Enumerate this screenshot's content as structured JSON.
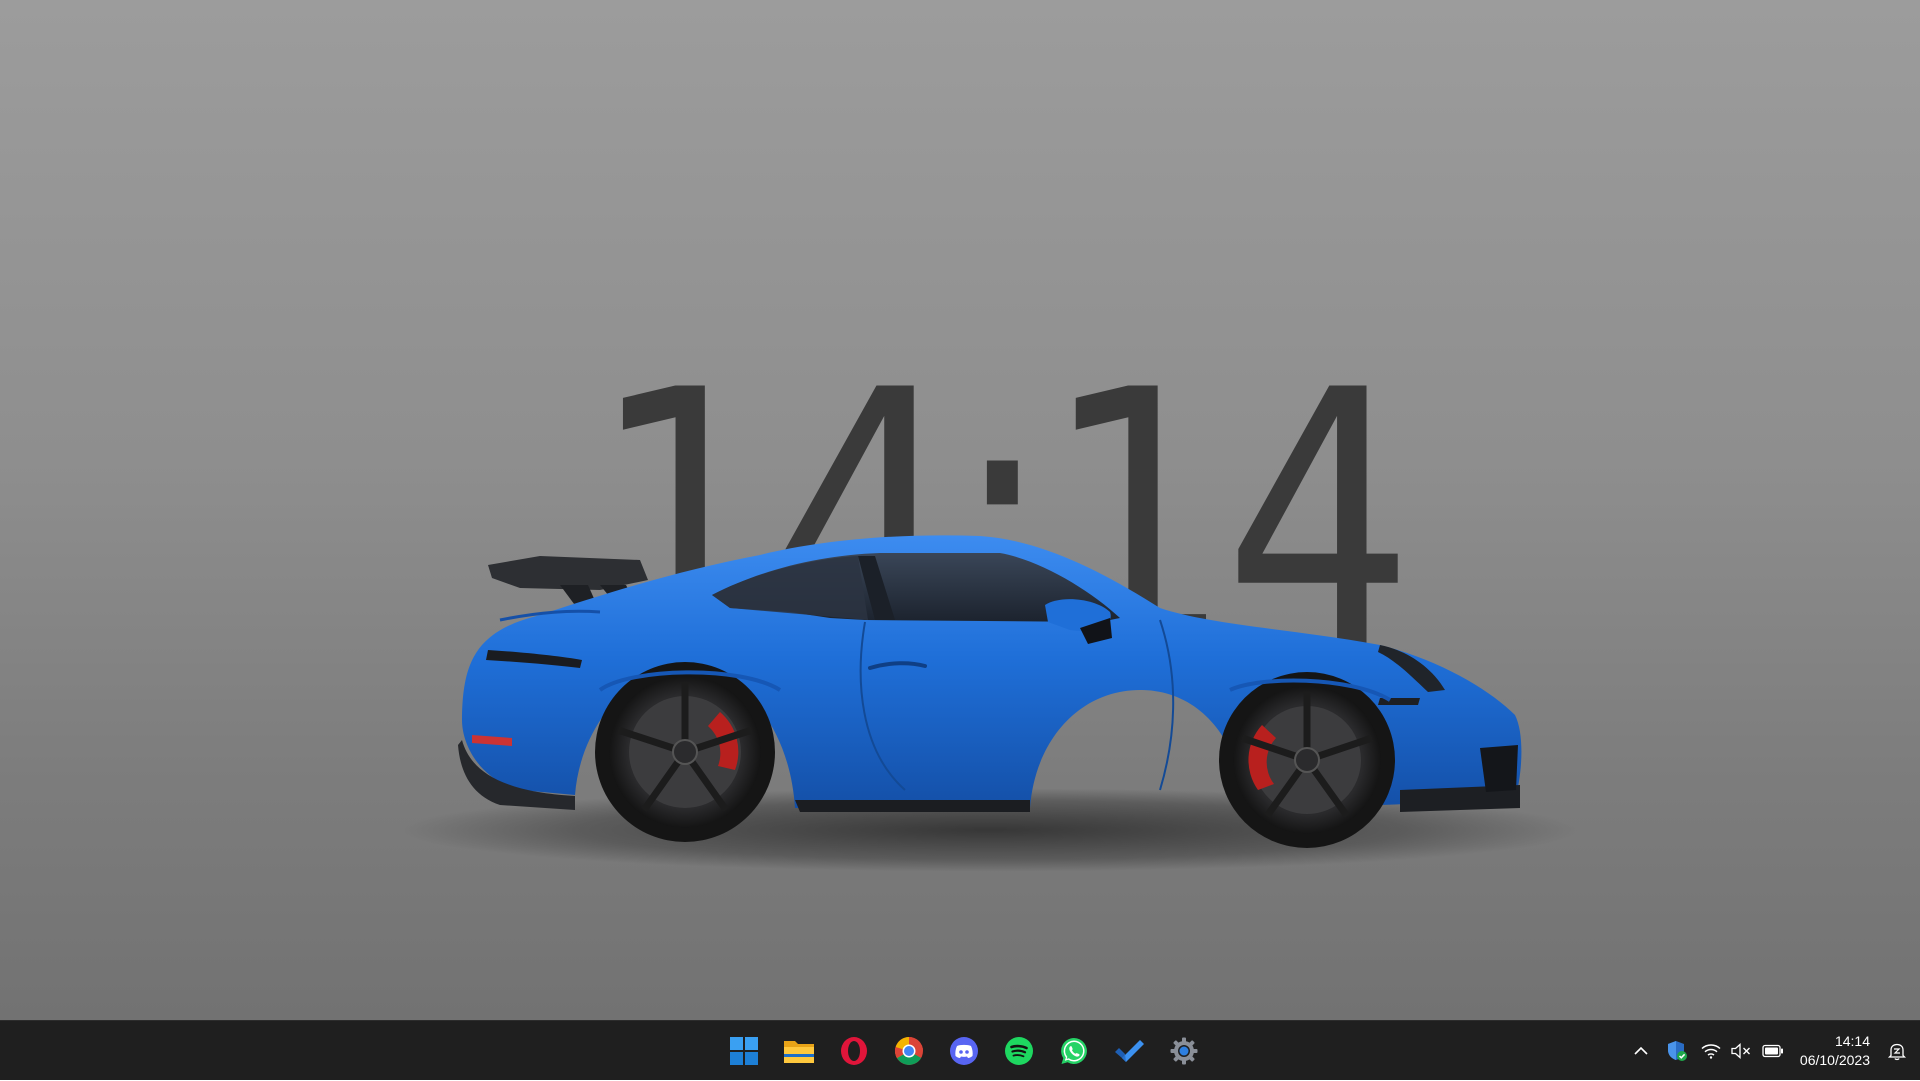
{
  "wallpaper": {
    "clock_text": "14:14"
  },
  "taskbar": {
    "apps": [
      {
        "name": "Start",
        "icon": "windows-start-icon"
      },
      {
        "name": "File Explorer",
        "icon": "file-explorer-icon"
      },
      {
        "name": "Opera",
        "icon": "opera-icon"
      },
      {
        "name": "Google Chrome",
        "icon": "chrome-icon"
      },
      {
        "name": "Discord",
        "icon": "discord-icon"
      },
      {
        "name": "Spotify",
        "icon": "spotify-icon"
      },
      {
        "name": "WhatsApp",
        "icon": "whatsapp-icon"
      },
      {
        "name": "Microsoft To Do",
        "icon": "todo-check-icon"
      },
      {
        "name": "Settings",
        "icon": "settings-gear-icon"
      }
    ],
    "tray": {
      "icons": [
        "chevron-up-icon",
        "windows-security-icon",
        "wifi-icon",
        "volume-muted-icon",
        "battery-icon",
        "notification-bell-icon"
      ],
      "time": "14:14",
      "date": "06/10/2023"
    }
  },
  "colors": {
    "taskbar_bg": "#1f1f1f",
    "car_body": "#1f6fd8",
    "clock_text": "#3a3a3a"
  }
}
